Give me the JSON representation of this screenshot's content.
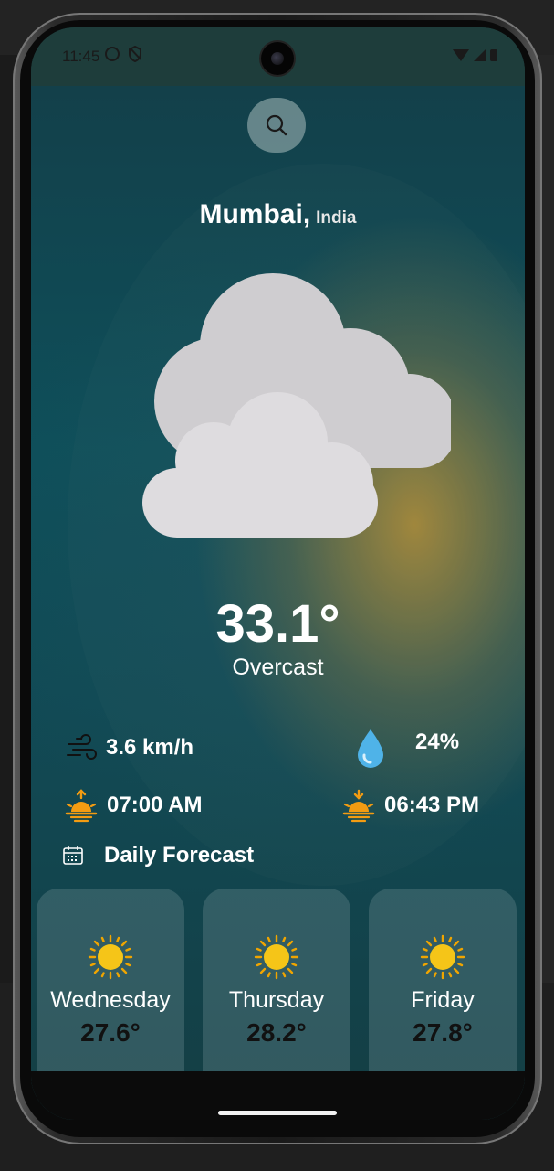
{
  "status": {
    "time": "11:45"
  },
  "search": {
    "icon": "search-icon"
  },
  "location": {
    "city": "Mumbai,",
    "country": "India"
  },
  "current": {
    "temperature": "33.1°",
    "condition": "Overcast",
    "icon": "cloud-icon"
  },
  "stats": {
    "wind": "3.6 km/h",
    "humidity": "24%",
    "sunrise": "07:00 AM",
    "sunset": "06:43 PM"
  },
  "daily": {
    "title": "Daily Forecast",
    "days": [
      {
        "day": "Wednesday",
        "temp": "27.6°"
      },
      {
        "day": "Thursday",
        "temp": "28.2°"
      },
      {
        "day": "Friday",
        "temp": "27.8°"
      }
    ]
  },
  "colors": {
    "sun": "#f5c518",
    "sun_ray": "#f0a500",
    "cloud": "#d0ced1",
    "accent_orange": "#f39c12"
  }
}
